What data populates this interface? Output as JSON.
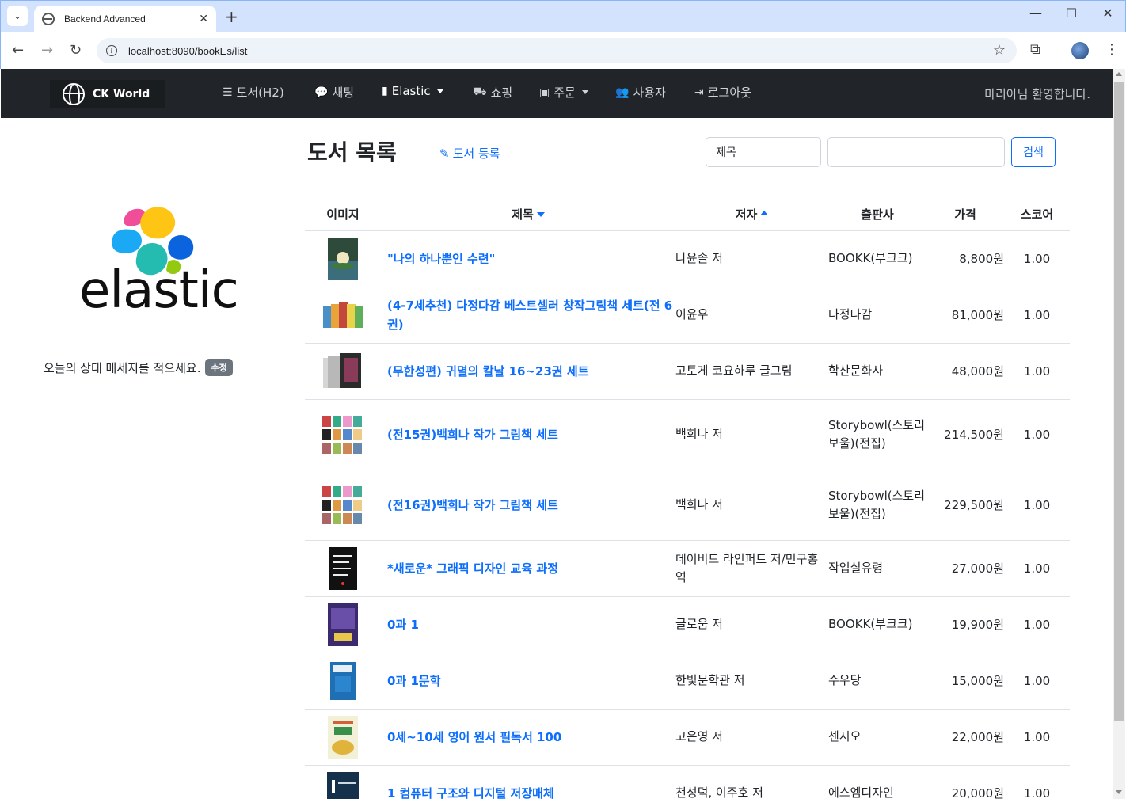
{
  "browser": {
    "tab_title": "Backend Advanced",
    "url": "localhost:8090/bookEs/list"
  },
  "navbar": {
    "brand": "CK World",
    "items": [
      {
        "label": "도서(H2)",
        "icon": "list-icon"
      },
      {
        "label": "채팅",
        "icon": "chat-icon"
      },
      {
        "label": "Elastic",
        "icon": "book-icon",
        "dropdown": true
      },
      {
        "label": "쇼핑",
        "icon": "basket-icon"
      },
      {
        "label": "주문",
        "icon": "bag-icon",
        "dropdown": true
      },
      {
        "label": "사용자",
        "icon": "users-icon"
      },
      {
        "label": "로그아웃",
        "icon": "logout-icon"
      }
    ],
    "welcome": "마리아님 환영합니다."
  },
  "sidebar": {
    "logo_text": "elastic",
    "status_message": "오늘의 상태 메세지를 적으세요.",
    "edit_label": "수정"
  },
  "main": {
    "title": "도서 목록",
    "register_label": "도서 등록",
    "search_field": "제목",
    "search_value": "",
    "search_button": "검색",
    "columns": [
      "이미지",
      "제목",
      "저자",
      "출판사",
      "가격",
      "스코어"
    ],
    "rows": [
      {
        "title": "\"나의 하나뿐인 수련\"",
        "author": "나윤솔 저",
        "publisher": "BOOKK(부크크)",
        "price": "8,800원",
        "score": "1.00",
        "cover": "lotus-cover"
      },
      {
        "title": "(4-7세추천) 다정다감 베스트셀러 창작그림책 세트(전 6권)",
        "author": "이윤우",
        "publisher": "다정다감",
        "price": "81,000원",
        "score": "1.00",
        "cover": "set-cover"
      },
      {
        "title": "(무한성편) 귀멸의 칼날 16~23권 세트",
        "author": "고토게 코요하루 글그림",
        "publisher": "학산문화사",
        "price": "48,000원",
        "score": "1.00",
        "cover": "box-cover"
      },
      {
        "title": "(전15권)백희나 작가 그림책 세트",
        "author": "백희나 저",
        "publisher": "Storybowl(스토리보울)(전집)",
        "price": "214,500원",
        "score": "1.00",
        "cover": "grid-cover"
      },
      {
        "title": "(전16권)백희나 작가 그림책 세트",
        "author": "백희나 저",
        "publisher": "Storybowl(스토리보울)(전집)",
        "price": "229,500원",
        "score": "1.00",
        "cover": "grid-cover"
      },
      {
        "title": "*새로운* 그래픽 디자인 교육 과정",
        "author": "데이비드 라인퍼트 저/민구홍 역",
        "publisher": "작업실유령",
        "price": "27,000원",
        "score": "1.00",
        "cover": "design-cover"
      },
      {
        "title": "0과 1",
        "author": "글로움 저",
        "publisher": "BOOKK(부크크)",
        "price": "19,900원",
        "score": "1.00",
        "cover": "purple-cover"
      },
      {
        "title": "0과 1문학",
        "author": "한빛문학관 저",
        "publisher": "수우당",
        "price": "15,000원",
        "score": "1.00",
        "cover": "blue-cover"
      },
      {
        "title": "0세~10세 영어 원서 필독서 100",
        "author": "고은영 저",
        "publisher": "센시오",
        "price": "22,000원",
        "score": "1.00",
        "cover": "green-cover"
      },
      {
        "title": "1 컴퓨터 구조와 디지털 저장매체",
        "author": "천성덕, 이주호 저",
        "publisher": "에스엠디자인",
        "price": "20,000원",
        "score": "1.00",
        "cover": "teal-cover"
      }
    ]
  },
  "colors": {
    "navbar_bg": "#212529",
    "link": "#0d6efd",
    "chrome_bg": "#d3e3fd"
  }
}
